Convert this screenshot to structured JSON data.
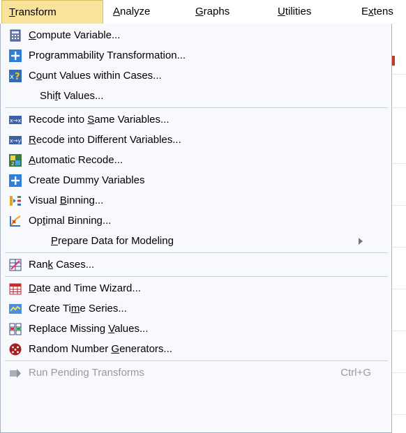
{
  "menubar": {
    "items": [
      {
        "label": "Transform",
        "accel": "T",
        "rest": "ransform"
      },
      {
        "label": "Analyze",
        "accel": "A",
        "rest": "nalyze"
      },
      {
        "label": "Graphs",
        "accel": "G",
        "rest": "raphs"
      },
      {
        "label": "Utilities",
        "accel": "U",
        "rest": "tilities"
      },
      {
        "label": "Extens",
        "pre": "E",
        "accel": "x",
        "rest": "tens"
      }
    ]
  },
  "menu": {
    "items": [
      {
        "pre": "",
        "accel": "C",
        "post": "ompute Variable...",
        "icon": "calculator-icon"
      },
      {
        "pre": "Programmability Transformation...",
        "accel": "",
        "post": "",
        "icon": "plus-icon"
      },
      {
        "pre": "C",
        "accel": "o",
        "post": "unt Values within Cases...",
        "icon": "count-values-icon"
      },
      {
        "pre": "Shi",
        "accel": "f",
        "post": "t Values...",
        "icon": ""
      },
      {
        "pre": "Recode into ",
        "accel": "S",
        "post": "ame Variables...",
        "icon": "recode-same-icon"
      },
      {
        "pre": "",
        "accel": "R",
        "post": "ecode into Different Variables...",
        "icon": "recode-different-icon"
      },
      {
        "pre": "",
        "accel": "A",
        "post": "utomatic Recode...",
        "icon": "automatic-recode-icon"
      },
      {
        "pre": "Create Dummy Variables",
        "accel": "",
        "post": "",
        "icon": "plus-icon"
      },
      {
        "pre": "Visual ",
        "accel": "B",
        "post": "inning...",
        "icon": "visual-binning-icon"
      },
      {
        "pre": "Op",
        "accel": "t",
        "post": "imal Binning...",
        "icon": "optimal-binning-icon"
      },
      {
        "pre": "",
        "accel": "P",
        "post": "repare Data for Modeling",
        "icon": ""
      },
      {
        "pre": "Ran",
        "accel": "k",
        "post": " Cases...",
        "icon": "rank-cases-icon"
      },
      {
        "pre": "",
        "accel": "D",
        "post": "ate and Time Wizard...",
        "icon": "date-time-icon"
      },
      {
        "pre": "Create Ti",
        "accel": "m",
        "post": "e Series...",
        "icon": "time-series-icon"
      },
      {
        "pre": "Replace Missing ",
        "accel": "V",
        "post": "alues...",
        "icon": "replace-missing-icon"
      },
      {
        "pre": "Random Number ",
        "accel": "G",
        "post": "enerators...",
        "icon": "dice-icon"
      },
      {
        "pre": "Run Pending Transforms",
        "accel": "",
        "post": "",
        "icon": "run-pending-icon",
        "shortcut": "Ctrl+G"
      }
    ]
  },
  "colors": {
    "active_menu_bg": "#f9e39b",
    "menu_bg": "#f7f9fc",
    "icon_blue": "#2e7fd6",
    "disabled_text": "#9a9a9a"
  }
}
